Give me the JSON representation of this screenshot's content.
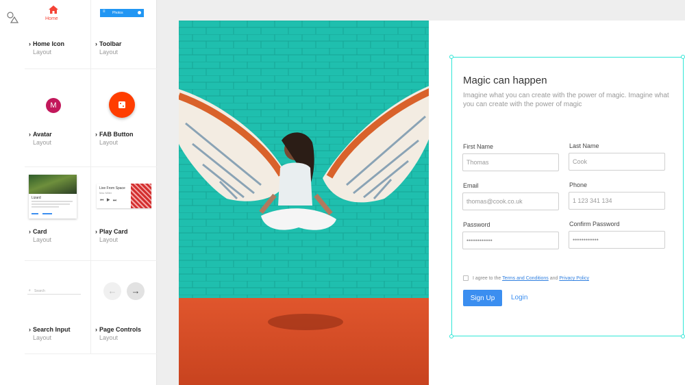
{
  "library": {
    "items": [
      {
        "name": "Home Icon",
        "sub": "Layout",
        "preview_label": "Home"
      },
      {
        "name": "Toolbar",
        "sub": "Layout",
        "preview_label": "Photos"
      },
      {
        "name": "Avatar",
        "sub": "Layout",
        "preview_label": "M"
      },
      {
        "name": "FAB Button",
        "sub": "Layout"
      },
      {
        "name": "Card",
        "sub": "Layout",
        "preview_title": "Lizard"
      },
      {
        "name": "Play Card",
        "sub": "Layout",
        "preview_title": "Live From Space",
        "preview_sub": "Mac Miller"
      },
      {
        "name": "Search Input",
        "sub": "Layout",
        "preview_placeholder": "Search"
      },
      {
        "name": "Page Controls",
        "sub": "Layout"
      }
    ]
  },
  "colors": {
    "accent": "#2ee6d6",
    "primary": "#3b8ef0",
    "home_red": "#f44336",
    "avatar": "#c2185b",
    "fab": "#ff3d00",
    "toolbar": "#2196f3"
  },
  "form": {
    "title": "Magic can happen",
    "lead": "Imagine what you can create with the power of magic. Imagine what you can create with the power of magic",
    "fields": {
      "first_name": {
        "label": "First Name",
        "value": "Thomas"
      },
      "last_name": {
        "label": "Last Name",
        "value": "Cook"
      },
      "email": {
        "label": "Email",
        "value": "thomas@cook.co.uk"
      },
      "phone": {
        "label": "Phone",
        "value": "1 123 341 134"
      },
      "password": {
        "label": "Password",
        "value": "••••••••••••"
      },
      "confirm_password": {
        "label": "Confirm Password",
        "value": "••••••••••••"
      }
    },
    "agree_prefix": "I agree to the",
    "terms_link": "Terms and Conditions",
    "agree_and": "and",
    "privacy_link": "Privacy Policy",
    "signup_label": "Sign Up",
    "login_label": "Login"
  }
}
